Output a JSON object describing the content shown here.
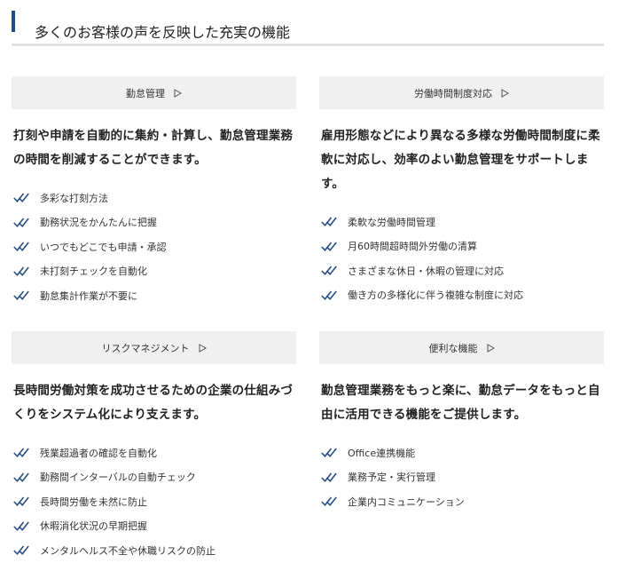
{
  "header": {
    "title": "多くのお客様の声を反映した充実の機能"
  },
  "colors": {
    "accent": "#1d4b8f",
    "check": "#2a4f86",
    "button_bg": "#f0f0f0",
    "rule": "#e1e1e1"
  },
  "icons": {
    "check": "double-check-icon",
    "button_arrow": "triangle-right-icon"
  },
  "sections": [
    {
      "button_label": "勤怠管理",
      "description": "打刻や申請を自動的に集約・計算し、勤怠管理業務の時間を削減することができます。",
      "features": [
        "多彩な打刻方法",
        "勤務状況をかんたんに把握",
        "いつでもどこでも申請・承認",
        "未打刻チェックを自動化",
        "勤怠集計作業が不要に"
      ]
    },
    {
      "button_label": "労働時間制度対応",
      "description": "雇用形態などにより異なる多様な労働時間制度に柔軟に対応し、効率のよい勤怠管理をサポートします。",
      "features": [
        "柔軟な労働時間管理",
        "月60時間超時間外労働の清算",
        "さまざまな休日・休暇の管理に対応",
        "働き方の多様化に伴う複雑な制度に対応"
      ]
    },
    {
      "button_label": "リスクマネジメント",
      "description": "長時間労働対策を成功させるための企業の仕組みづくりをシステム化により支えます。",
      "features": [
        "残業超過者の確認を自動化",
        "勤務間インターバルの自動チェック",
        "長時間労働を未然に防止",
        "休暇消化状況の早期把握",
        "メンタルヘルス不全や休職リスクの防止"
      ]
    },
    {
      "button_label": "便利な機能",
      "description": "勤怠管理業務をもっと楽に、勤怠データをもっと自由に活用できる機能をご提供します。",
      "features": [
        "Office連携機能",
        "業務予定・実行管理",
        "企業内コミュニケーション"
      ]
    }
  ]
}
